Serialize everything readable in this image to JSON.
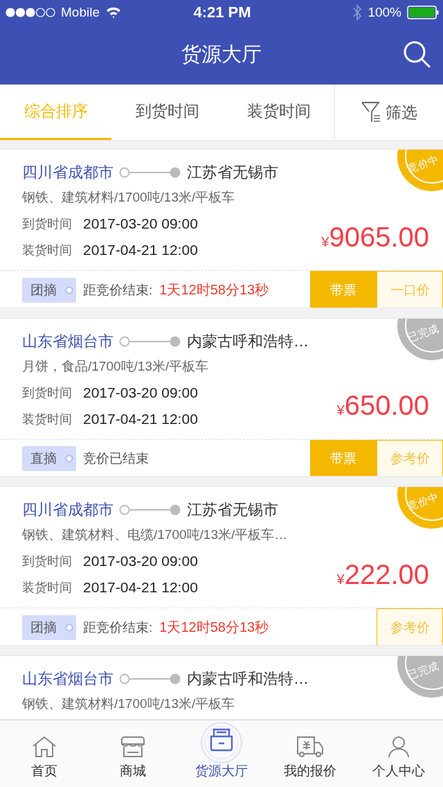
{
  "status_bar": {
    "carrier": "Mobile",
    "time": "4:21 PM",
    "battery": "100%"
  },
  "header": {
    "title": "货源大厅"
  },
  "sort_tabs": [
    {
      "label": "综合排序",
      "selected": true
    },
    {
      "label": "到货时间",
      "selected": false
    },
    {
      "label": "装货时间",
      "selected": false
    }
  ],
  "filter": {
    "label": "筛选"
  },
  "cards": [
    {
      "from": "四川省成都市",
      "to": "江苏省无锡市",
      "cargo": "钢铁、建筑材料/1700吨/13米/平板车",
      "arrival_label": "到货时间",
      "arrival": "2017-03-20 09:00",
      "loading_label": "装货时间",
      "loading": "2017-04-21 12:00",
      "currency": "¥",
      "price": "9065.00",
      "stamp": {
        "kind": "bidding",
        "text": "竞价中"
      },
      "tag": "团摘",
      "status_label": "距竞价结束:",
      "countdown": "1天12时58分13秒",
      "buttons": [
        {
          "kind": "ticket",
          "label": "带票"
        },
        {
          "kind": "price",
          "label": "一口价"
        }
      ]
    },
    {
      "from": "山东省烟台市",
      "to": "内蒙古呼和浩特…",
      "cargo": "月饼，食品/1700吨/13米/平板车",
      "arrival_label": "到货时间",
      "arrival": "2017-03-20 09:00",
      "loading_label": "装货时间",
      "loading": "2017-04-21 12:00",
      "currency": "¥",
      "price": "650.00",
      "stamp": {
        "kind": "done",
        "text": "已完成"
      },
      "tag": "直摘",
      "status_label": "竞价已结束",
      "buttons": [
        {
          "kind": "ticket",
          "label": "带票"
        },
        {
          "kind": "price",
          "label": "参考价"
        }
      ]
    },
    {
      "from": "四川省成都市",
      "to": "江苏省无锡市",
      "cargo": "钢铁、建筑材料、电缆/1700吨/13米/平板车…",
      "arrival_label": "到货时间",
      "arrival": "2017-03-20 09:00",
      "loading_label": "装货时间",
      "loading": "2017-04-21 12:00",
      "currency": "¥",
      "price": "222.00",
      "stamp": {
        "kind": "bidding",
        "text": "竞价中"
      },
      "tag": "团摘",
      "status_label": "距竞价结束:",
      "countdown": "1天12时58分13秒",
      "buttons": [
        {
          "kind": "price",
          "label": "参考价"
        }
      ]
    },
    {
      "from": "山东省烟台市",
      "to": "内蒙古呼和浩特…",
      "cargo": "钢铁、建筑材料/1700吨/13米/平板车",
      "stamp": {
        "kind": "done",
        "text": "已完成"
      }
    }
  ],
  "bottom_nav": [
    {
      "kind": "home",
      "label": "首页",
      "selected": false
    },
    {
      "kind": "shop",
      "label": "商城",
      "selected": false
    },
    {
      "kind": "cargo",
      "label": "货源大厅",
      "selected": true
    },
    {
      "kind": "quote",
      "label": "我的报价",
      "selected": false
    },
    {
      "kind": "user",
      "label": "个人中心",
      "selected": false
    }
  ]
}
